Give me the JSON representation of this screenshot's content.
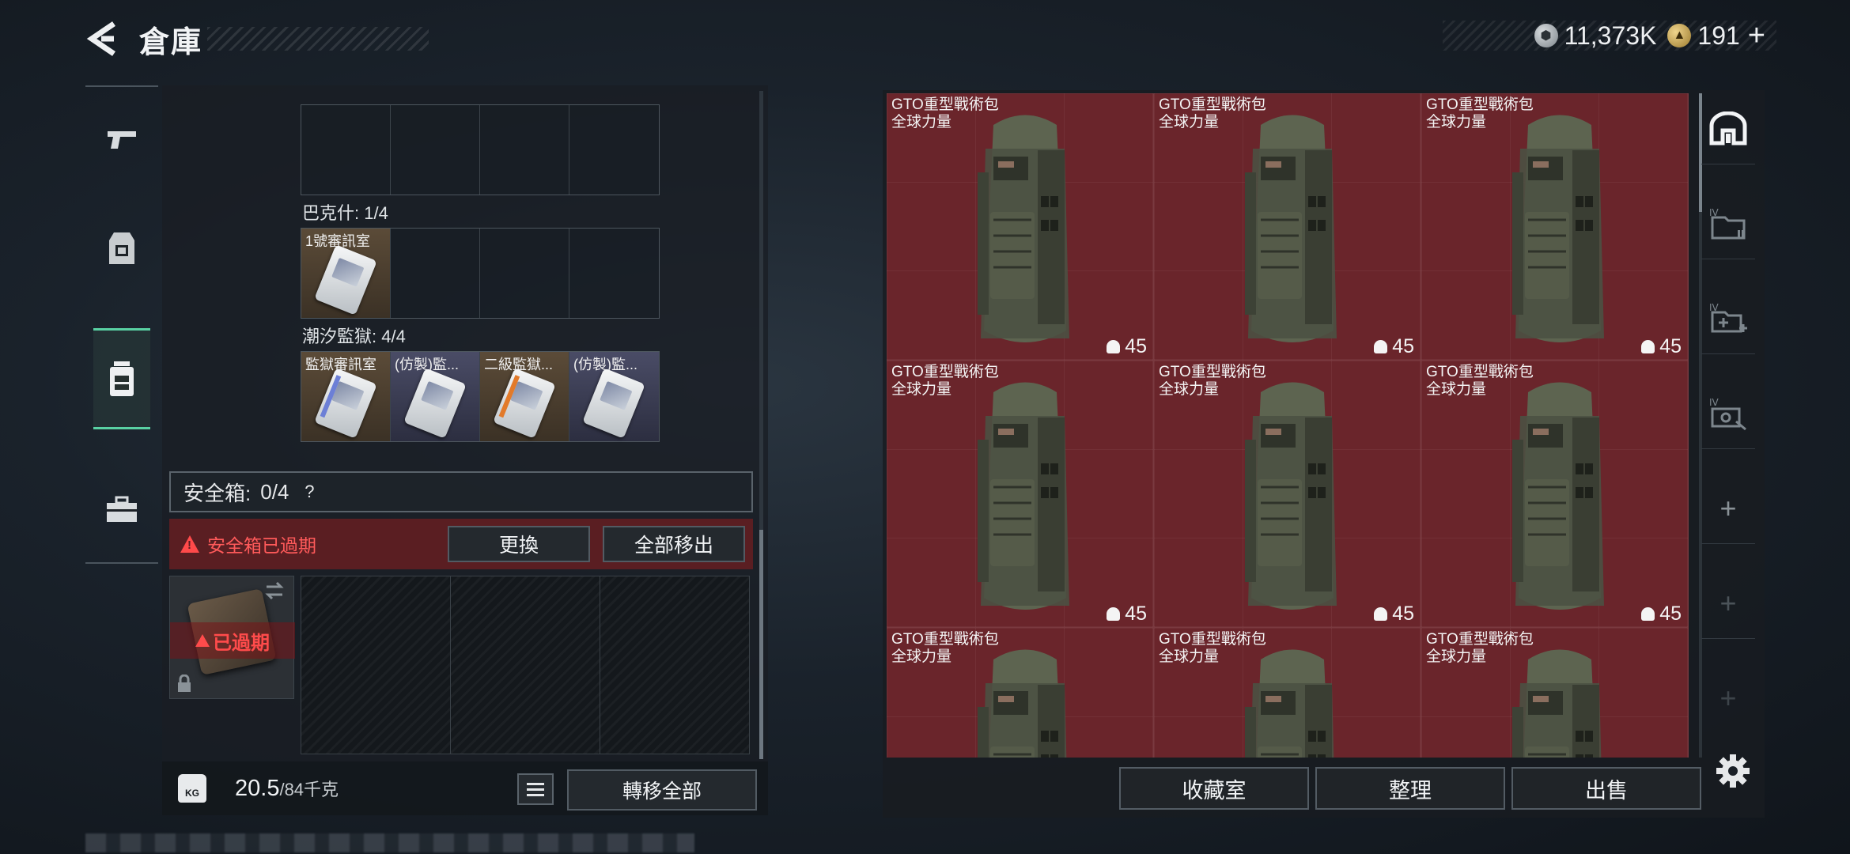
{
  "header": {
    "title": "倉庫",
    "silver_amount": "11,373K",
    "gold_amount": "191",
    "plus_label": "+"
  },
  "left_categories": [
    {
      "name": "weapons",
      "icon": "pistol-icon"
    },
    {
      "name": "gear",
      "icon": "vest-icon"
    },
    {
      "name": "backpack",
      "icon": "backpack-icon",
      "active": true
    },
    {
      "name": "supplies",
      "icon": "briefcase-icon"
    }
  ],
  "key_sections": {
    "section_bakesh": {
      "label": "巴克什: 1/4",
      "items": [
        {
          "label": "1號審訊室",
          "style": "gold"
        }
      ]
    },
    "section_tide_prison": {
      "label": "潮汐監獄: 4/4",
      "items": [
        {
          "label": "監獄審訊室",
          "style": "gold"
        },
        {
          "label": "(仿製)監...",
          "style": "blue"
        },
        {
          "label": "二級監獄...",
          "style": "gold"
        },
        {
          "label": "(仿製)監...",
          "style": "blue"
        }
      ]
    }
  },
  "safe_box": {
    "label": "安全箱:",
    "count": "0/4",
    "help": "?",
    "expired_warning": "安全箱已過期",
    "replace_button": "更換",
    "remove_all_button": "全部移出",
    "expired_tag": "已過期"
  },
  "weight": {
    "icon_text": "KG",
    "current": "20.5",
    "max": "/84千克"
  },
  "transfer_all_button": "轉移全部",
  "stash": {
    "items": [
      {
        "name_line1": "GTO重型戰術包",
        "name_line2": "全球力量",
        "count": "45"
      },
      {
        "name_line1": "GTO重型戰術包",
        "name_line2": "全球力量",
        "count": "45"
      },
      {
        "name_line1": "GTO重型戰術包",
        "name_line2": "全球力量",
        "count": "45"
      },
      {
        "name_line1": "GTO重型戰術包",
        "name_line2": "全球力量",
        "count": "45"
      },
      {
        "name_line1": "GTO重型戰術包",
        "name_line2": "全球力量",
        "count": "45"
      },
      {
        "name_line1": "GTO重型戰術包",
        "name_line2": "全球力量",
        "count": "45"
      },
      {
        "name_line1": "GTO重型戰術包",
        "name_line2": "全球力量",
        "count": ""
      },
      {
        "name_line1": "GTO重型戰術包",
        "name_line2": "全球力量",
        "count": ""
      },
      {
        "name_line1": "GTO重型戰術包",
        "name_line2": "全球力量",
        "count": ""
      }
    ]
  },
  "right_rail": {
    "tab1_icon": "stash-icon",
    "tab2_icon": "folder-iv-icon",
    "tab3_icon": "folder-plus-iv-icon",
    "tab4_icon": "tools-iv-icon",
    "add1": "+",
    "add2": "+",
    "add3": "+"
  },
  "bottom_buttons": {
    "collection": "收藏室",
    "organize": "整理",
    "sell": "出售"
  },
  "colors": {
    "accent": "#59d1a3",
    "stash_bg": "#6a252b",
    "warning": "#ff4a4a"
  }
}
